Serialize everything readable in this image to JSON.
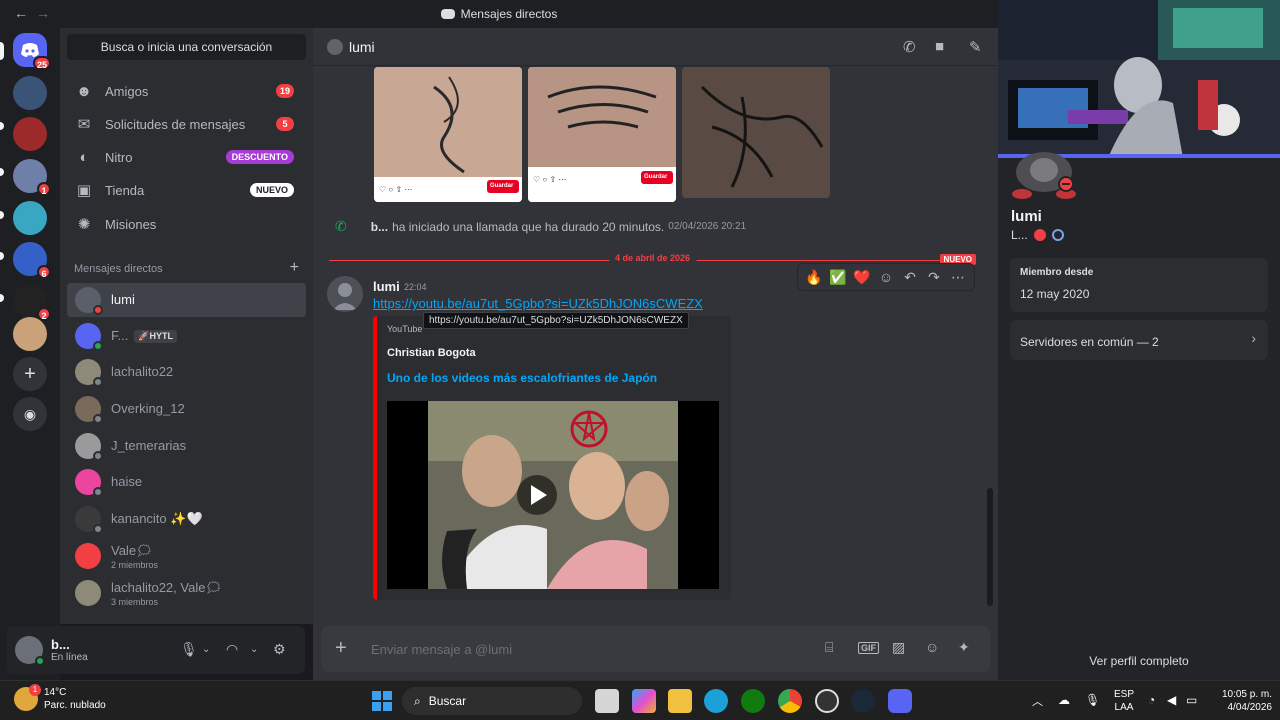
{
  "titlebar": {
    "title": "Mensajes directos",
    "back": "←",
    "forward": "→"
  },
  "servers": [
    {
      "name": "discord-home",
      "color": "#5865f2",
      "badge": "25"
    },
    {
      "name": "server-1",
      "color": "#3a5478",
      "badge": ""
    },
    {
      "name": "server-2",
      "color": "#9c2a2a",
      "badge": ""
    },
    {
      "name": "server-3",
      "color": "#6e7fa8",
      "badge": "1"
    },
    {
      "name": "server-4",
      "color": "#3aa7c2",
      "badge": ""
    },
    {
      "name": "server-5",
      "color": "#3460c8",
      "badge": "6"
    },
    {
      "name": "server-6",
      "color": "#222",
      "badge": "2"
    },
    {
      "name": "server-7",
      "color": "#c9a27a",
      "badge": ""
    }
  ],
  "channels": {
    "search": "Busca o inicia una conversación",
    "nav": [
      {
        "label": "Amigos",
        "icon": "friends-icon",
        "glyph": "☻",
        "count": "19"
      },
      {
        "label": "Solicitudes de mensajes",
        "icon": "mail-icon",
        "glyph": "✉",
        "count": "5"
      },
      {
        "label": "Nitro",
        "icon": "nitro-icon",
        "glyph": "◐",
        "tag": "DESCUENTO"
      },
      {
        "label": "Tienda",
        "icon": "shop-icon",
        "glyph": "▣",
        "tag": "NUEVO"
      },
      {
        "label": "Misiones",
        "icon": "quests-icon",
        "glyph": "✺"
      }
    ],
    "dm_header": "Mensajes directos",
    "dms": [
      {
        "name": "lumi",
        "color": "#5a5f6a",
        "status": "#f23f43",
        "active": true
      },
      {
        "name": "F...",
        "extra": "🚀HYTL",
        "color": "#5865f2",
        "status": "#23a55a"
      },
      {
        "name": "lachalito22",
        "color": "#8e8a7a",
        "status": "#80848e"
      },
      {
        "name": "Overking_12",
        "color": "#7a6a5a",
        "status": "#80848e"
      },
      {
        "name": "J_temerarias",
        "color": "#9a9a9a",
        "status": "#80848e"
      },
      {
        "name": "haise",
        "color": "#eb459e",
        "status": "#80848e"
      },
      {
        "name": "kanancito ✨🤍",
        "color": "#3a3a3a",
        "status": "#80848e"
      },
      {
        "name": "Vale🗯",
        "sub": "2 miembros",
        "color": "#f23f43",
        "status": ""
      },
      {
        "name": "lachalito22, Vale🗯",
        "sub": "3 miembros",
        "color": "#8e8a7a",
        "status": ""
      }
    ]
  },
  "user": {
    "name": "b...",
    "status": "En línea"
  },
  "chat": {
    "recipient": "lumi",
    "call": {
      "user": "b...",
      "text": "ha iniciado una llamada que ha durado 20 minutos.",
      "time": "02/04/2026 20:21"
    },
    "date_divider": "4 de abril de 2026",
    "new_label": "NUEVO",
    "message": {
      "author": "lumi",
      "time": "22:04",
      "link": "https://youtu.be/au7ut_5Gpbo?si=UZk5DhJON6sCWEZX",
      "tooltip": "https://youtu.be/au7ut_5Gpbo?si=UZk5DhJON6sCWEZX",
      "embed": {
        "provider": "YouTube",
        "author": "Christian Bogota",
        "title": "Uno de los videos más escalofriantes de Japón"
      }
    },
    "image_buttons": {
      "save": "Guardar"
    },
    "reactions": [
      "🔥",
      "✅",
      "❤️"
    ],
    "composer_placeholder": "Enviar mensaje a @lumi"
  },
  "profile": {
    "name": "lumi",
    "status": "L...",
    "member_since_label": "Miembro desde",
    "member_since": "12 may 2020",
    "mutual_servers": "Servidores en común — 2",
    "view_full": "Ver perfil completo"
  },
  "taskbar": {
    "temp": "14°C",
    "weather": "Parc. nublado",
    "search": "Buscar",
    "lang1": "ESP",
    "lang2": "LAA",
    "time": "10:05 p. m.",
    "date": "4/04/2026"
  },
  "colors": {
    "accent": "#5865f2",
    "danger": "#f23f43",
    "link": "#00a8fc",
    "online": "#23a55a"
  }
}
